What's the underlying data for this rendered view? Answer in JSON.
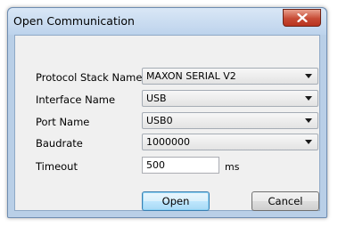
{
  "window": {
    "title": "Open Communication"
  },
  "form": {
    "protocol_label": "Protocol Stack Name",
    "protocol_value": "MAXON SERIAL V2",
    "interface_label": "Interface Name",
    "interface_value": "USB",
    "port_label": "Port Name",
    "port_value": "USB0",
    "baudrate_label": "Baudrate",
    "baudrate_value": "1000000",
    "timeout_label": "Timeout",
    "timeout_value": "500",
    "timeout_unit": "ms"
  },
  "buttons": {
    "open_label": "Open",
    "cancel_label": "Cancel"
  },
  "icons": {
    "close": "close-icon",
    "dropdown": "chevron-down-icon"
  },
  "colors": {
    "close_button": "#c74b35",
    "default_button_border": "#3c7fb1",
    "frame": "#b9cfe7"
  }
}
